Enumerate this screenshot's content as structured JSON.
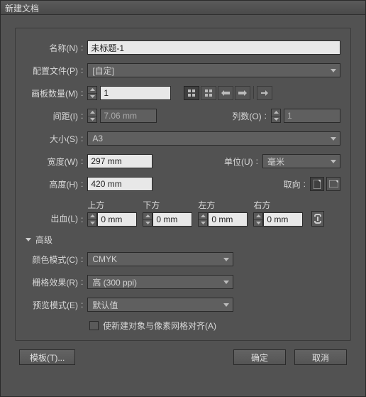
{
  "title": "新建文档",
  "labels": {
    "name": "名称(N)",
    "profile": "配置文件(P)",
    "artboards": "画板数量(M)",
    "spacing": "间距(I)",
    "columns": "列数(O)",
    "size": "大小(S)",
    "width": "宽度(W)",
    "height": "高度(H)",
    "units": "单位(U)",
    "orientation": "取向",
    "bleed": "出血(L)",
    "bleed_top": "上方",
    "bleed_bottom": "下方",
    "bleed_left": "左方",
    "bleed_right": "右方",
    "advanced": "高级",
    "color_mode": "颜色模式(C)",
    "raster": "栅格效果(R)",
    "preview": "预览模式(E)",
    "align_pixel": "使新建对象与像素网格对齐(A)"
  },
  "values": {
    "name": "未标题-1",
    "profile": "[自定]",
    "artboards": "1",
    "spacing": "7.06 mm",
    "columns": "1",
    "size": "A3",
    "width": "297 mm",
    "height": "420 mm",
    "units": "毫米",
    "bleed_top": "0 mm",
    "bleed_bottom": "0 mm",
    "bleed_left": "0 mm",
    "bleed_right": "0 mm",
    "color_mode": "CMYK",
    "raster": "高 (300 ppi)",
    "preview": "默认值"
  },
  "buttons": {
    "template": "模板(T)...",
    "ok": "确定",
    "cancel": "取消"
  }
}
